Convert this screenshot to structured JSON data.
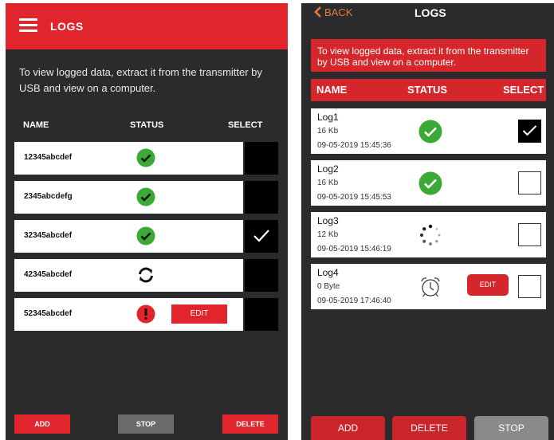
{
  "left": {
    "title": "LOGS",
    "info": "To view logged data, extract it from the transmitter by USB and view on a computer.",
    "columns": {
      "name": "NAME",
      "status": "STATUS",
      "select": "SELECT"
    },
    "rows": [
      {
        "name": "12345abcdef",
        "status": "success",
        "selected": false
      },
      {
        "name": "2345abcdefg",
        "status": "success",
        "selected": false
      },
      {
        "name": "32345abcdef",
        "status": "success",
        "selected": true
      },
      {
        "name": "42345abcdef",
        "status": "syncing",
        "selected": false
      },
      {
        "name": "52345abcdef",
        "status": "error",
        "selected": false,
        "edit_label": "EDIT"
      }
    ],
    "buttons": {
      "add": "ADD",
      "stop": "STOP",
      "delete": "DELETE"
    }
  },
  "right": {
    "back": "BACK",
    "title": "LOGS",
    "info": "To view logged data, extract it from the transmitter by USB and view on a computer.",
    "columns": {
      "name": "NAME",
      "status": "STATUS",
      "select": "SELECT"
    },
    "rows": [
      {
        "name": "Log1",
        "size": "16 Kb",
        "date": "09-05-2019 15:45:36",
        "status": "success",
        "selected": true
      },
      {
        "name": "Log2",
        "size": "16 Kb",
        "date": "09-05-2019 15:45:53",
        "status": "success",
        "selected": false
      },
      {
        "name": "Log3",
        "size": "12 Kb",
        "date": "09-05-2019 15:46:19",
        "status": "loading",
        "selected": false
      },
      {
        "name": "Log4",
        "size": "0 Byte",
        "date": "09-05-2019 17:46:40",
        "status": "scheduled",
        "selected": false,
        "edit_label": "EDIT"
      }
    ],
    "buttons": {
      "add": "ADD",
      "delete": "DELETE",
      "stop": "STOP"
    }
  },
  "colors": {
    "brand_red": "#e0262c",
    "success_green": "#3aa935",
    "back_orange": "#e57a3c",
    "background_dark": "#2b2b2d",
    "disabled_gray": "#6a6a6a"
  }
}
